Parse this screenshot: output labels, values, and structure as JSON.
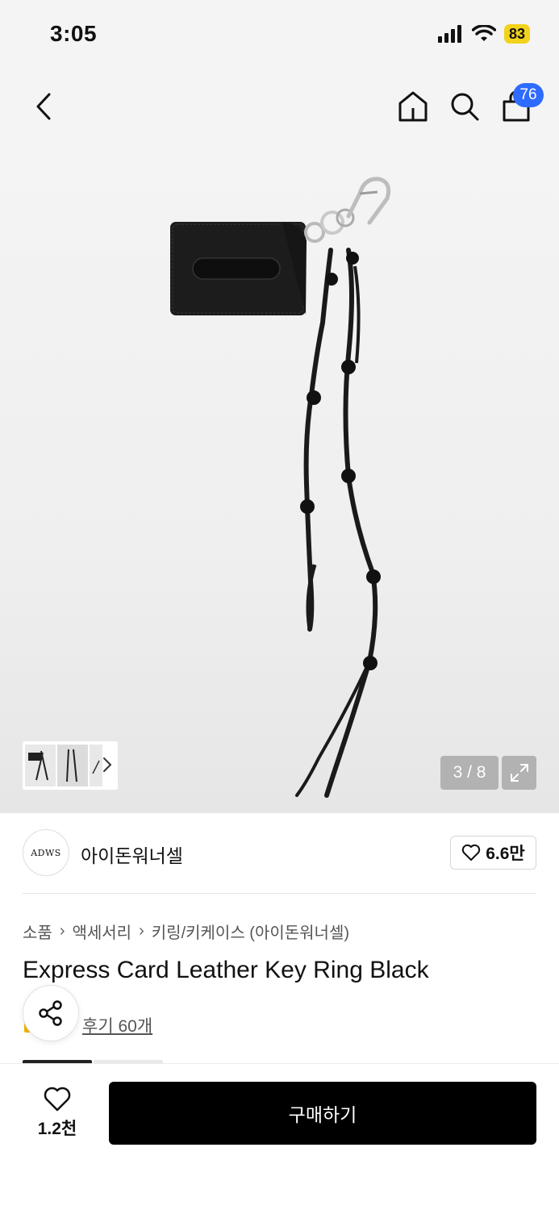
{
  "status_bar": {
    "time": "3:05",
    "battery": "83"
  },
  "nav": {
    "cart_count": "76"
  },
  "gallery": {
    "page_indicator": "3 / 8"
  },
  "brand": {
    "logo_text": "ADWS",
    "name": "아이돈워너셀",
    "like_count": "6.6만"
  },
  "breadcrumb": [
    "소품",
    "액세서리",
    "키링/키케이스 (아이돈워너셀)"
  ],
  "product": {
    "title": "Express Card Leather Key Ring Black",
    "reviews": "후기 60개"
  },
  "bottom_bar": {
    "like_count": "1.2천",
    "buy_label": "구매하기"
  },
  "colors": {
    "accent_badge": "#2f6bff",
    "battery": "#f2d21c",
    "buy_button": "#000000"
  }
}
